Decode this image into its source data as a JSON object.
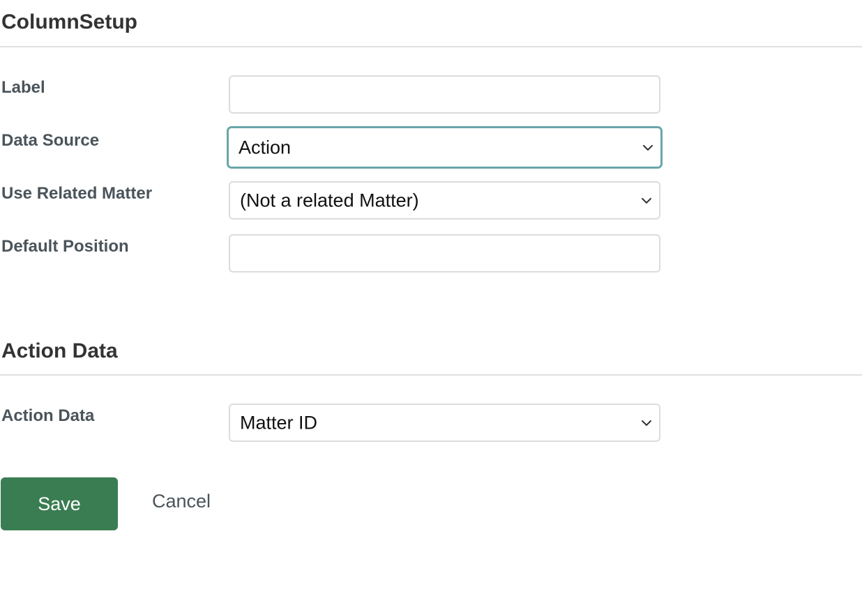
{
  "column_setup": {
    "title": "ColumnSetup",
    "fields": {
      "label": {
        "label": "Label",
        "value": ""
      },
      "data_source": {
        "label": "Data Source",
        "value": "Action"
      },
      "use_related_matter": {
        "label": "Use Related Matter",
        "value": "(Not a related Matter)"
      },
      "default_position": {
        "label": "Default Position",
        "value": ""
      }
    }
  },
  "action_data_section": {
    "title": "Action Data",
    "field": {
      "label": "Action Data",
      "value": "Matter ID"
    }
  },
  "buttons": {
    "save_label": "Save",
    "cancel_label": "Cancel"
  },
  "colors": {
    "save_button": "#3a7d52",
    "focus_border": "#6aa6a8",
    "label_text": "#4a545a"
  },
  "icons": {
    "select_arrow": "chevron-down-icon"
  }
}
